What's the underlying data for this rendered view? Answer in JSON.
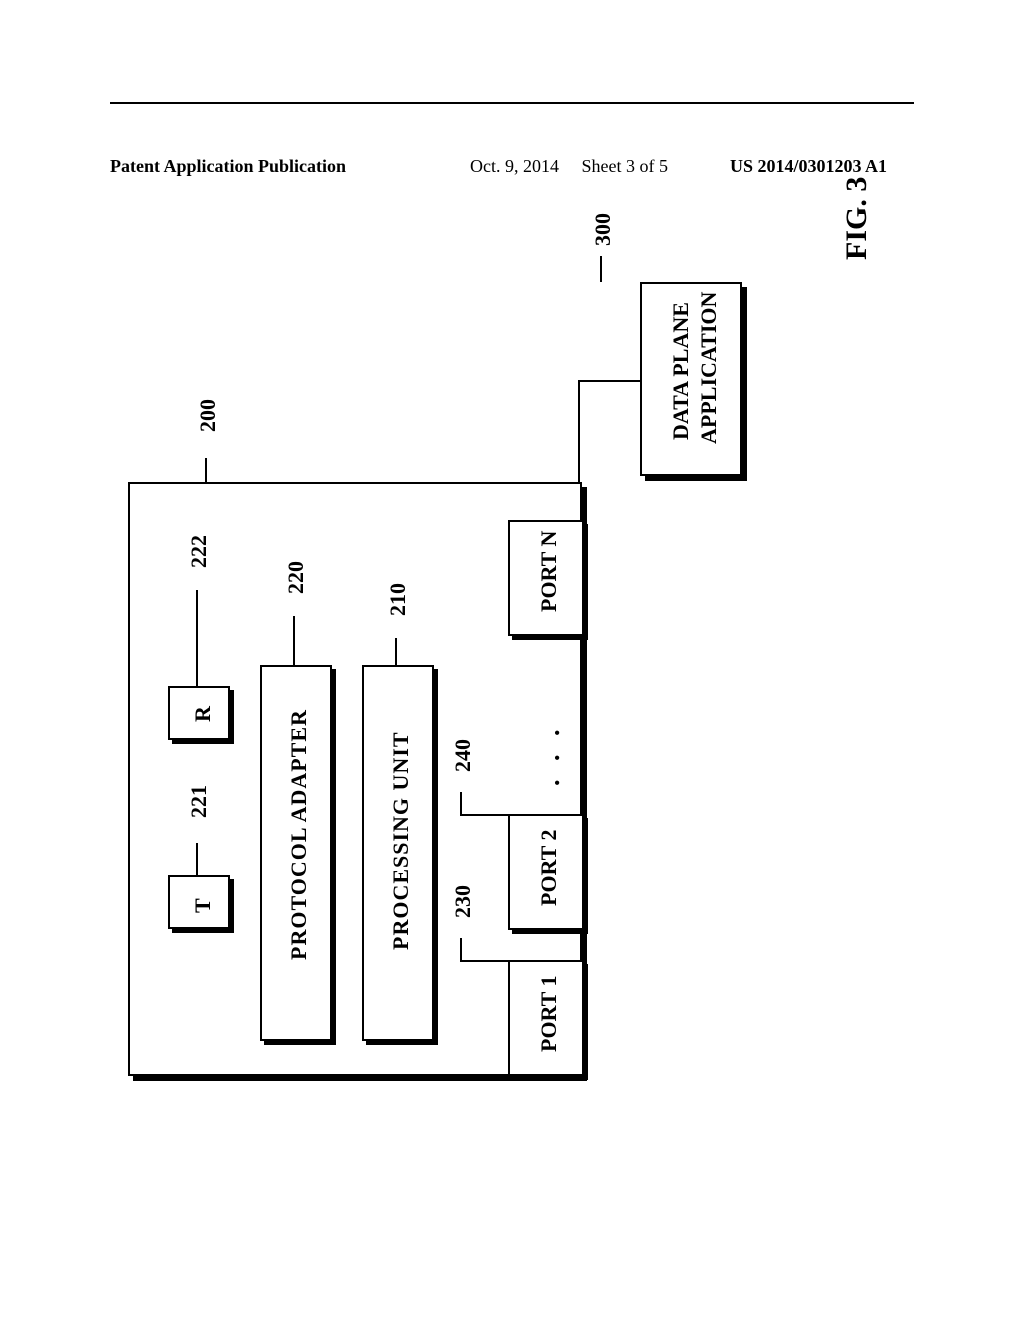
{
  "header": {
    "left": "Patent Application Publication",
    "date": "Oct. 9, 2014",
    "sheet": "Sheet 3 of 5",
    "pubno": "US 2014/0301203 A1"
  },
  "figure": {
    "title": "FIG. 3"
  },
  "callouts": {
    "c200": "200",
    "c210": "210",
    "c220": "220",
    "c221": "221",
    "c222": "222",
    "c230": "230",
    "c240": "240",
    "c300": "300"
  },
  "blocks": {
    "t": "T",
    "r": "R",
    "protocol_adapter": "PROTOCOL ADAPTER",
    "processing_unit": "PROCESSING UNIT",
    "port1": "PORT 1",
    "port2": "PORT 2",
    "portn": "PORT N",
    "ellipsis": ". . .",
    "data_plane": "DATA PLANE",
    "application": "APPLICATION"
  }
}
